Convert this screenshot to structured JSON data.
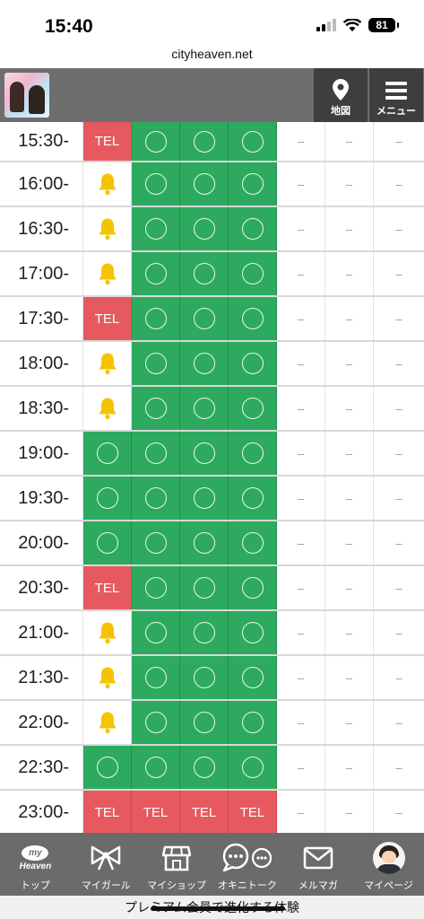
{
  "status_bar": {
    "time": "15:40",
    "battery": "81"
  },
  "browser": {
    "url": "cityheaven.net"
  },
  "header": {
    "map_label": "地図",
    "menu_label": "メニュー"
  },
  "schedule": {
    "legend": {
      "available": "〇",
      "tel": "TEL",
      "notify": "bell-icon",
      "closed": "–"
    },
    "rows": [
      {
        "time": "15:30-",
        "slots": [
          "tel",
          "open",
          "open",
          "open",
          "none",
          "none",
          "none"
        ]
      },
      {
        "time": "16:00-",
        "slots": [
          "bell",
          "open",
          "open",
          "open",
          "none",
          "none",
          "none"
        ]
      },
      {
        "time": "16:30-",
        "slots": [
          "bell",
          "open",
          "open",
          "open",
          "none",
          "none",
          "none"
        ]
      },
      {
        "time": "17:00-",
        "slots": [
          "bell",
          "open",
          "open",
          "open",
          "none",
          "none",
          "none"
        ]
      },
      {
        "time": "17:30-",
        "slots": [
          "tel",
          "open",
          "open",
          "open",
          "none",
          "none",
          "none"
        ]
      },
      {
        "time": "18:00-",
        "slots": [
          "bell",
          "open",
          "open",
          "open",
          "none",
          "none",
          "none"
        ]
      },
      {
        "time": "18:30-",
        "slots": [
          "bell",
          "open",
          "open",
          "open",
          "none",
          "none",
          "none"
        ]
      },
      {
        "time": "19:00-",
        "slots": [
          "open",
          "open",
          "open",
          "open",
          "none",
          "none",
          "none"
        ]
      },
      {
        "time": "19:30-",
        "slots": [
          "open",
          "open",
          "open",
          "open",
          "none",
          "none",
          "none"
        ]
      },
      {
        "time": "20:00-",
        "slots": [
          "open",
          "open",
          "open",
          "open",
          "none",
          "none",
          "none"
        ]
      },
      {
        "time": "20:30-",
        "slots": [
          "tel",
          "open",
          "open",
          "open",
          "none",
          "none",
          "none"
        ]
      },
      {
        "time": "21:00-",
        "slots": [
          "bell",
          "open",
          "open",
          "open",
          "none",
          "none",
          "none"
        ]
      },
      {
        "time": "21:30-",
        "slots": [
          "bell",
          "open",
          "open",
          "open",
          "none",
          "none",
          "none"
        ]
      },
      {
        "time": "22:00-",
        "slots": [
          "bell",
          "open",
          "open",
          "open",
          "none",
          "none",
          "none"
        ]
      },
      {
        "time": "22:30-",
        "slots": [
          "open",
          "open",
          "open",
          "open",
          "none",
          "none",
          "none"
        ]
      },
      {
        "time": "23:00-",
        "slots": [
          "tel",
          "tel",
          "tel",
          "tel",
          "none",
          "none",
          "none"
        ]
      }
    ]
  },
  "colors": {
    "available": "#2daa5f",
    "tel": "#e65a5f",
    "bell": "#f5c400",
    "header": "#6e6e6e",
    "header_button": "#3e3e3e"
  },
  "bottom_nav": [
    {
      "label": "トップ",
      "icon": "my-heaven-icon",
      "badge_top": "my",
      "badge_bottom": "Heaven"
    },
    {
      "label": "マイガール",
      "icon": "ribbon-icon"
    },
    {
      "label": "マイショップ",
      "icon": "shop-icon"
    },
    {
      "label": "オキニトーク",
      "icon": "chat-icon"
    },
    {
      "label": "メルマガ",
      "icon": "mail-icon"
    },
    {
      "label": "マイページ",
      "icon": "avatar-icon"
    }
  ],
  "promo": {
    "text": "プレミアム会員で進化する体験"
  }
}
